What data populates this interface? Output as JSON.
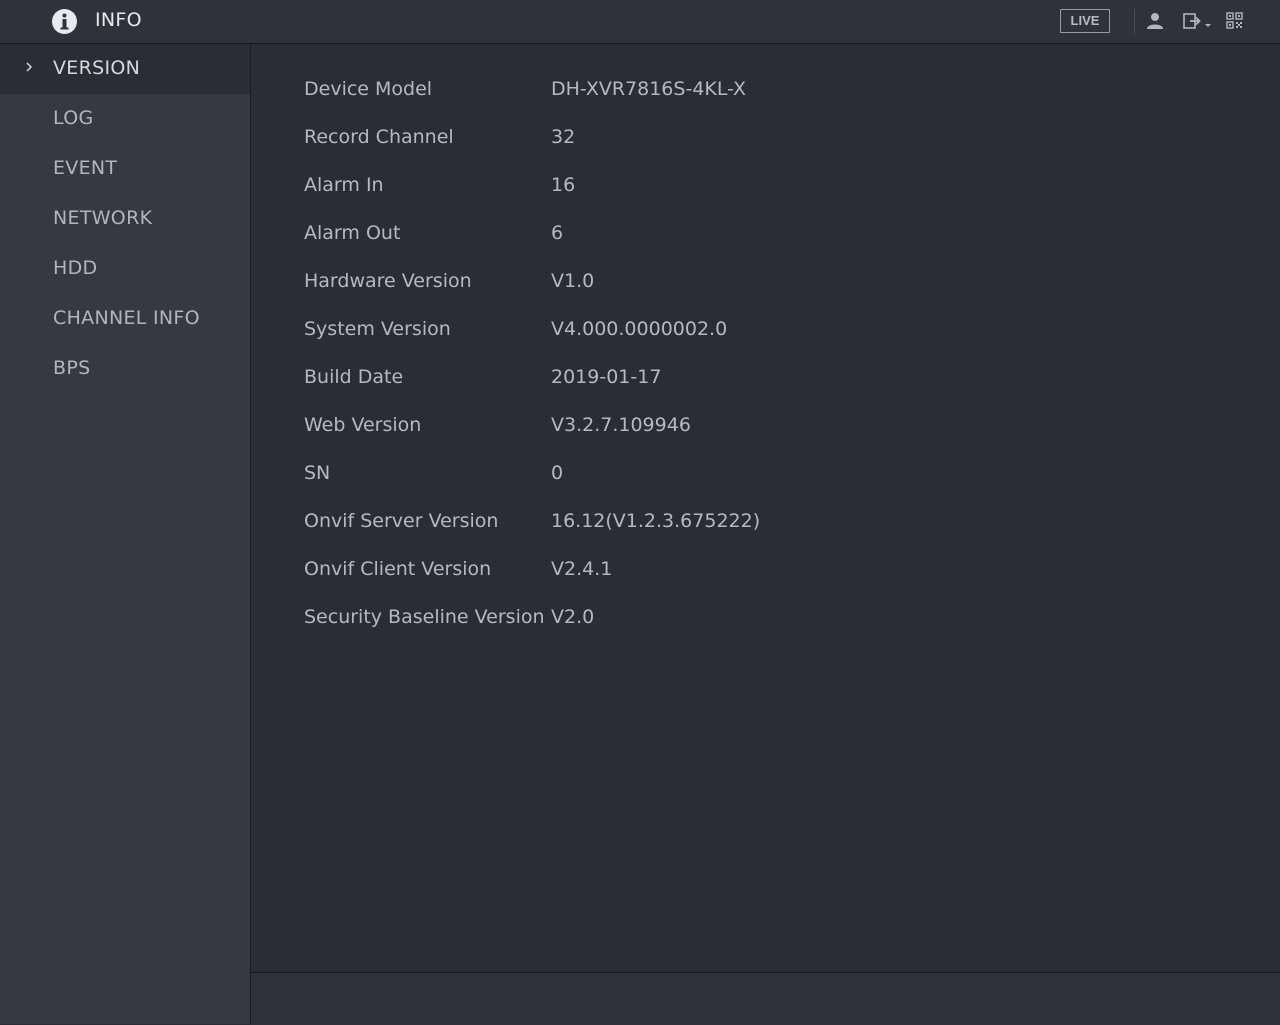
{
  "header": {
    "title": "INFO",
    "live_label": "LIVE",
    "icons": [
      "info-icon",
      "user-icon",
      "logout-icon",
      "qr-code-icon"
    ]
  },
  "sidebar": {
    "items": [
      {
        "label": "VERSION",
        "active": true
      },
      {
        "label": "LOG",
        "active": false
      },
      {
        "label": "EVENT",
        "active": false
      },
      {
        "label": "NETWORK",
        "active": false
      },
      {
        "label": "HDD",
        "active": false
      },
      {
        "label": "CHANNEL INFO",
        "active": false
      },
      {
        "label": "BPS",
        "active": false
      }
    ]
  },
  "version": {
    "rows": [
      {
        "label": "Device Model",
        "value": "DH-XVR7816S-4KL-X"
      },
      {
        "label": "Record Channel",
        "value": "32"
      },
      {
        "label": "Alarm In",
        "value": "16"
      },
      {
        "label": "Alarm Out",
        "value": "6"
      },
      {
        "label": "Hardware Version",
        "value": "V1.0"
      },
      {
        "label": "System Version",
        "value": "V4.000.0000002.0"
      },
      {
        "label": "Build Date",
        "value": "2019-01-17"
      },
      {
        "label": "Web Version",
        "value": "V3.2.7.109946"
      },
      {
        "label": "SN",
        "value": "0"
      },
      {
        "label": "Onvif Server Version",
        "value": "16.12(V1.2.3.675222)"
      },
      {
        "label": "Onvif Client Version",
        "value": "V2.4.1"
      },
      {
        "label": "Security Baseline Version",
        "value": "V2.0"
      }
    ]
  },
  "colors": {
    "background": "#2b2c36",
    "sidebar": "#373843",
    "topbar": "#30313b",
    "text": "#b7b9bf"
  }
}
